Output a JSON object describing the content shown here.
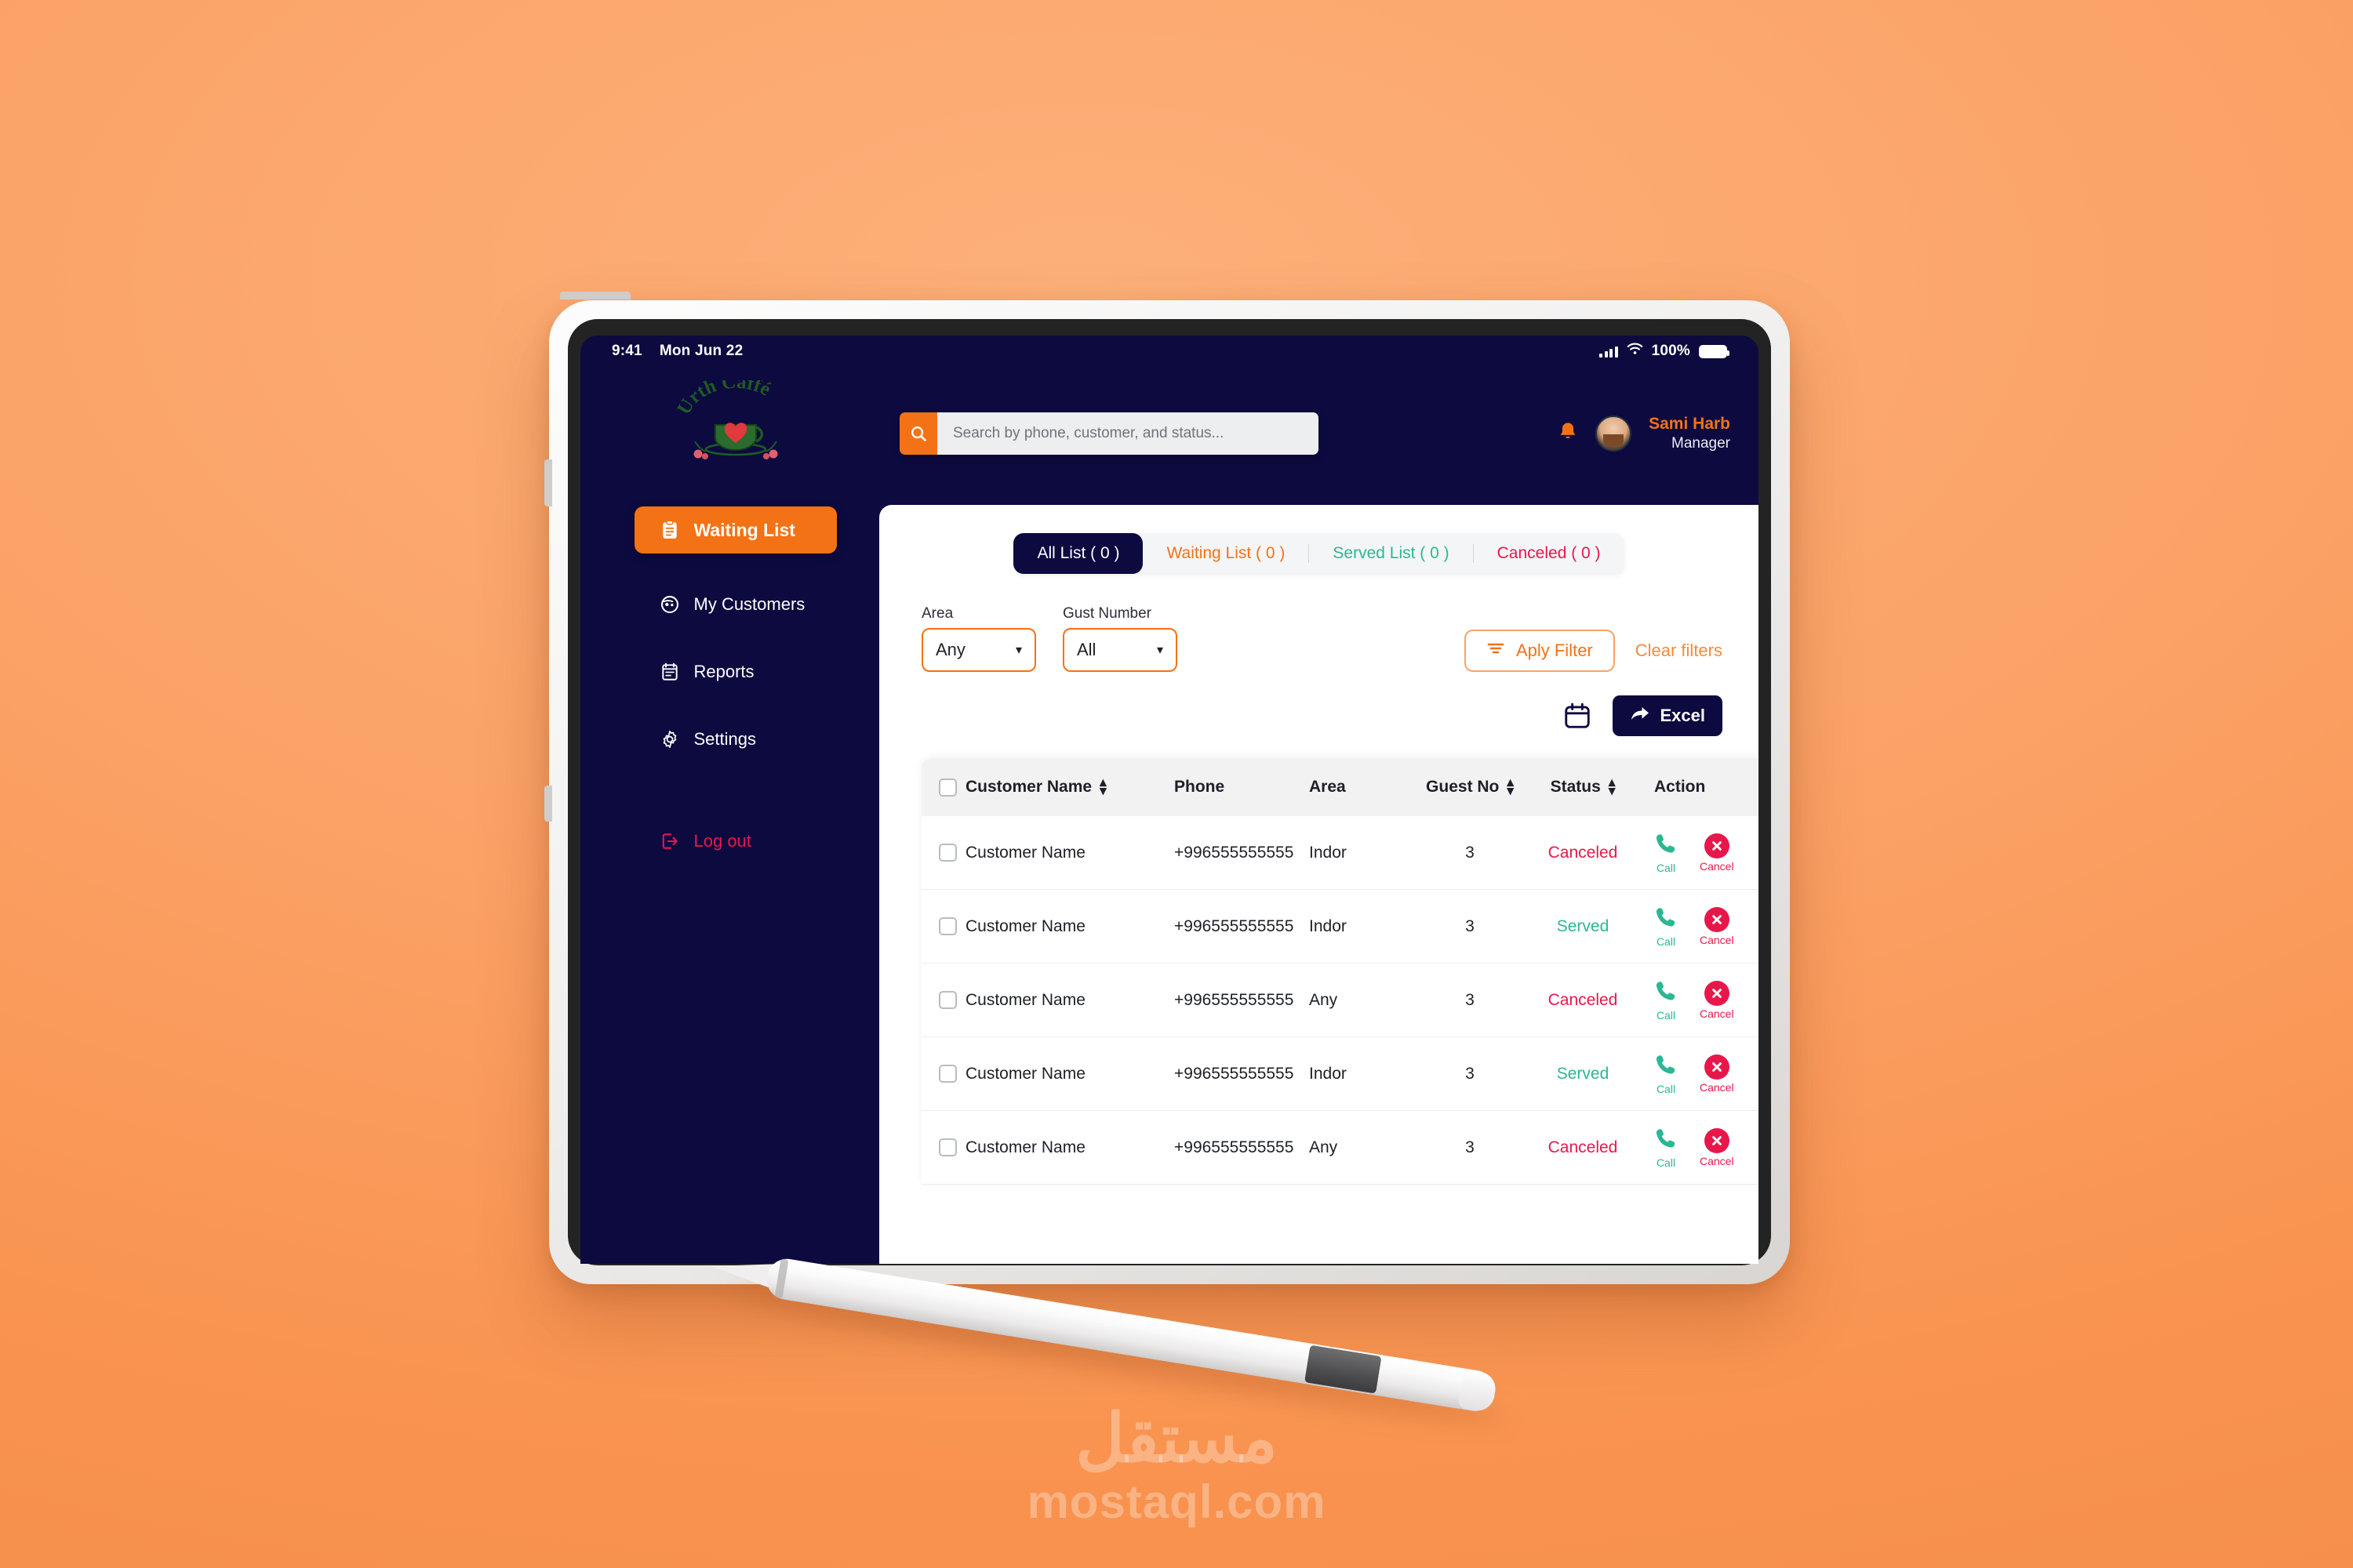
{
  "status_bar": {
    "time": "9:41",
    "date": "Mon Jun 22",
    "battery_percent": "100%",
    "signal_icon": "cellular-signal-icon",
    "wifi_icon": "wifi-icon",
    "battery_icon": "battery-full-icon"
  },
  "brand": {
    "logo_name": "urth-caffe-logo",
    "logo_text_top": "Urth Caffé"
  },
  "search": {
    "placeholder": "Search by phone, customer, and status...",
    "value": "",
    "icon": "search-icon"
  },
  "user": {
    "name": "Sami Harb",
    "role": "Manager",
    "avatar_icon": "user-avatar",
    "bell_icon": "notification-bell-icon"
  },
  "sidebar": {
    "primary": {
      "label": "Waiting List",
      "icon": "clipboard-list-icon"
    },
    "items": [
      {
        "label": "My Customers",
        "icon": "customers-icon"
      },
      {
        "label": "Reports",
        "icon": "reports-icon"
      },
      {
        "label": "Settings",
        "icon": "gear-icon"
      }
    ],
    "logout": {
      "label": "Log out",
      "icon": "logout-icon"
    }
  },
  "tabs": [
    {
      "label": "All List  ( 0 )",
      "state": "active"
    },
    {
      "label": "Waiting List  ( 0 )",
      "state": "waiting"
    },
    {
      "label": "Served List  ( 0 )",
      "state": "served"
    },
    {
      "label": "Canceled  ( 0 )",
      "state": "canceled"
    }
  ],
  "filters": {
    "area": {
      "label": "Area",
      "value": "Any"
    },
    "guest_number": {
      "label": "Gust Number",
      "value": "All"
    },
    "apply_label": "Aply Filter",
    "apply_icon": "filter-icon",
    "clear_label": "Clear filters"
  },
  "export": {
    "calendar_icon": "calendar-icon",
    "excel_label": "Excel",
    "excel_icon": "share-arrow-icon"
  },
  "table": {
    "columns": [
      {
        "label": "Customer Name",
        "sortable": true
      },
      {
        "label": "Phone",
        "sortable": false
      },
      {
        "label": "Area",
        "sortable": false
      },
      {
        "label": "Guest No",
        "sortable": true
      },
      {
        "label": "Status",
        "sortable": true
      },
      {
        "label": "Action",
        "sortable": false
      }
    ],
    "action_labels": {
      "call": "Call",
      "cancel": "Cancel"
    },
    "action_icons": {
      "call": "phone-icon",
      "cancel": "cancel-circle-x-icon"
    },
    "rows": [
      {
        "name": "Customer Name",
        "phone": "+996555555555",
        "area": "Indor",
        "guests": "3",
        "status": "Canceled"
      },
      {
        "name": "Customer Name",
        "phone": "+996555555555",
        "area": "Indor",
        "guests": "3",
        "status": "Served"
      },
      {
        "name": "Customer Name",
        "phone": "+996555555555",
        "area": "Any",
        "guests": "3",
        "status": "Canceled"
      },
      {
        "name": "Customer Name",
        "phone": "+996555555555",
        "area": "Indor",
        "guests": "3",
        "status": "Served"
      },
      {
        "name": "Customer Name",
        "phone": "+996555555555",
        "area": "Any",
        "guests": "3",
        "status": "Canceled"
      }
    ]
  },
  "watermark": {
    "arabic": "مستقل",
    "latin": "mostaql.com"
  },
  "colors": {
    "brand_orange": "#f47216",
    "navy": "#0d0a40",
    "green": "#2bb793",
    "red": "#e8174a",
    "background": "#fba267"
  }
}
